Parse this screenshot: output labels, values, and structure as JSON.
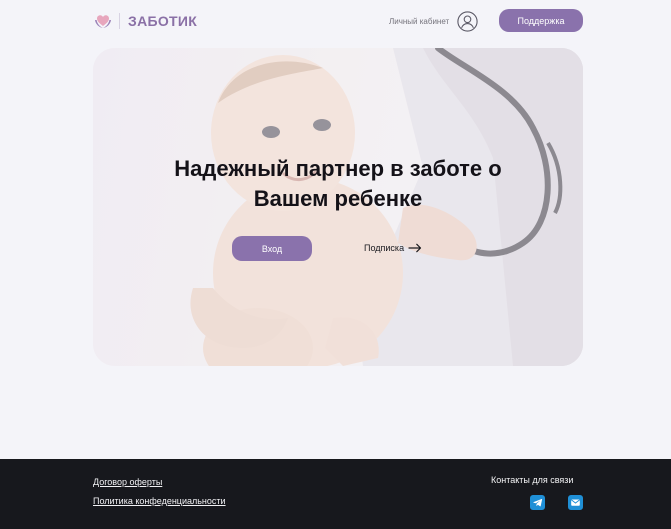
{
  "header": {
    "logo_text": "ЗАБОТИК",
    "cabinet_label": "Личный кабинет",
    "support_label": "Поддержка"
  },
  "hero": {
    "title_line1": "Надежный партнер в заботе о",
    "title_line2": "Вашем ребенке",
    "login_label": "Вход",
    "subscribe_label": "Подписка"
  },
  "footer": {
    "offer_link": "Договор оферты",
    "privacy_link": "Политика конфеденциальности",
    "contacts_title": "Контакты для связи",
    "socials": [
      "telegram-icon",
      "mail-icon"
    ]
  },
  "colors": {
    "accent": "#8a72ac",
    "background": "#f4f4f9",
    "footer": "#17181d",
    "social": "#1f8fd6"
  }
}
